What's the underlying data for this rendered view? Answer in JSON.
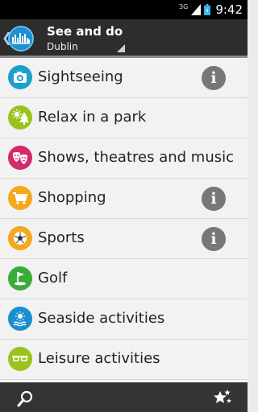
{
  "status_bar": {
    "network": "3G",
    "time": "9:42"
  },
  "action_bar": {
    "title": "See and do",
    "subtitle": "Dublin",
    "back_icon": "chevron-left-icon",
    "logo_icon": "app-logo-icon"
  },
  "categories": [
    {
      "label": "Sightseeing",
      "icon": "camera-icon",
      "color": "#1aa0cf",
      "info": true
    },
    {
      "label": "Relax in a park",
      "icon": "tree-sun-icon",
      "color": "#9ac31c",
      "info": false
    },
    {
      "label": "Shows, theatres and music",
      "icon": "theatre-masks-icon",
      "color": "#d22a6a",
      "info": false
    },
    {
      "label": "Shopping",
      "icon": "shopping-cart-icon",
      "color": "#f4a81a",
      "info": true
    },
    {
      "label": "Sports",
      "icon": "soccer-ball-icon",
      "color": "#f4a81a",
      "info": true
    },
    {
      "label": "Golf",
      "icon": "golf-flag-icon",
      "color": "#3aaa3a",
      "info": false
    },
    {
      "label": "Seaside activities",
      "icon": "seaside-icon",
      "color": "#1a8fd0",
      "info": false
    },
    {
      "label": "Leisure activities",
      "icon": "sunglasses-icon",
      "color": "#9ac31c",
      "info": false
    }
  ],
  "info_glyph": "i",
  "bottom_bar": {
    "search_icon": "search-icon",
    "favorites_icon": "star-favorites-icon"
  }
}
